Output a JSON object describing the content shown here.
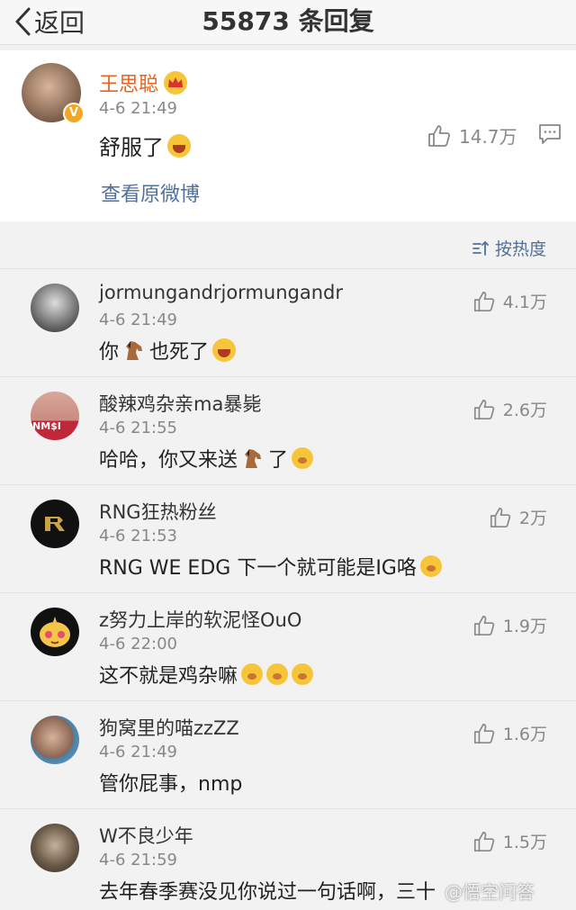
{
  "header": {
    "back_label": "返回",
    "title": "55873 条回复"
  },
  "post": {
    "author": "王思聪",
    "time": "4-6 21:49",
    "text": "舒服了",
    "link": "查看原微博",
    "likes": "14.7万",
    "verified_badge": "V"
  },
  "sort_label": "按热度",
  "comments": [
    {
      "name": "jormungandrjormungandr",
      "time": "4-6 21:49",
      "text_a": "你",
      "text_b": "也死了",
      "likes": "4.1万"
    },
    {
      "name": "酸辣鸡杂亲ma暴毙",
      "time": "4-6 21:55",
      "text_a": "哈哈，你又来送",
      "text_b": "了",
      "likes": "2.6万",
      "avatar_text": "NM$I"
    },
    {
      "name": "RNG狂热粉丝",
      "time": "4-6 21:53",
      "text": "RNG WE EDG 下一个就可能是IG咯",
      "likes": "2万"
    },
    {
      "name": "z努力上岸的软泥怪OuO",
      "time": "4-6 22:00",
      "text": "这不就是鸡杂嘛",
      "likes": "1.9万"
    },
    {
      "name": "狗窝里的喵zzZZ",
      "time": "4-6 21:49",
      "text": "管你屁事，nmp",
      "likes": "1.6万"
    },
    {
      "name": "W不良少年",
      "time": "4-6 21:59",
      "text": "去年春季赛没见你说过一句话啊，三十",
      "likes": "1.5万"
    }
  ],
  "watermark": "@悟空问答",
  "colors": {
    "accent_blue": "#50709a",
    "name_orange": "#e8631f",
    "background": "#f2f2f2"
  }
}
